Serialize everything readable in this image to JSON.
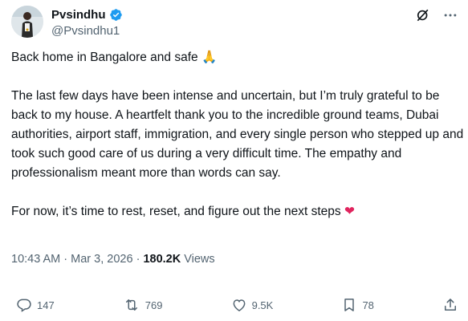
{
  "author": {
    "display_name": "Pvsindhu",
    "handle": "@Pvsindhu1"
  },
  "post": {
    "line1": "Back home in Bangalore and safe",
    "line1_emoji": "🙏",
    "paragraph2": "The last few days have been intense and uncertain, but I’m truly grateful to be back to my house. A heartfelt thank you to the incredible ground teams, Dubai authorities, airport staff, immigration, and every single person who stepped up and took such good care of us during a very difficult time. The empathy and professionalism meant more than words can say.",
    "paragraph3": "For now, it’s time to rest, reset, and figure out the next steps",
    "paragraph3_emoji": "❤"
  },
  "meta": {
    "time": "10:43 AM",
    "separator": " · ",
    "date": "Mar 3, 2026",
    "separator2": " · ",
    "views_count": "180.2K",
    "views_label": " Views"
  },
  "actions": {
    "replies": "147",
    "reposts": "769",
    "likes": "9.5K",
    "bookmarks": "78"
  },
  "icons": [
    "verified-badge-icon",
    "grok-icon",
    "more-icon",
    "reply-icon",
    "repost-icon",
    "like-icon",
    "bookmark-icon",
    "share-icon"
  ],
  "colors": {
    "verified": "#1d9bf0",
    "secondary_text": "#536471",
    "heart": "#e0245e"
  }
}
